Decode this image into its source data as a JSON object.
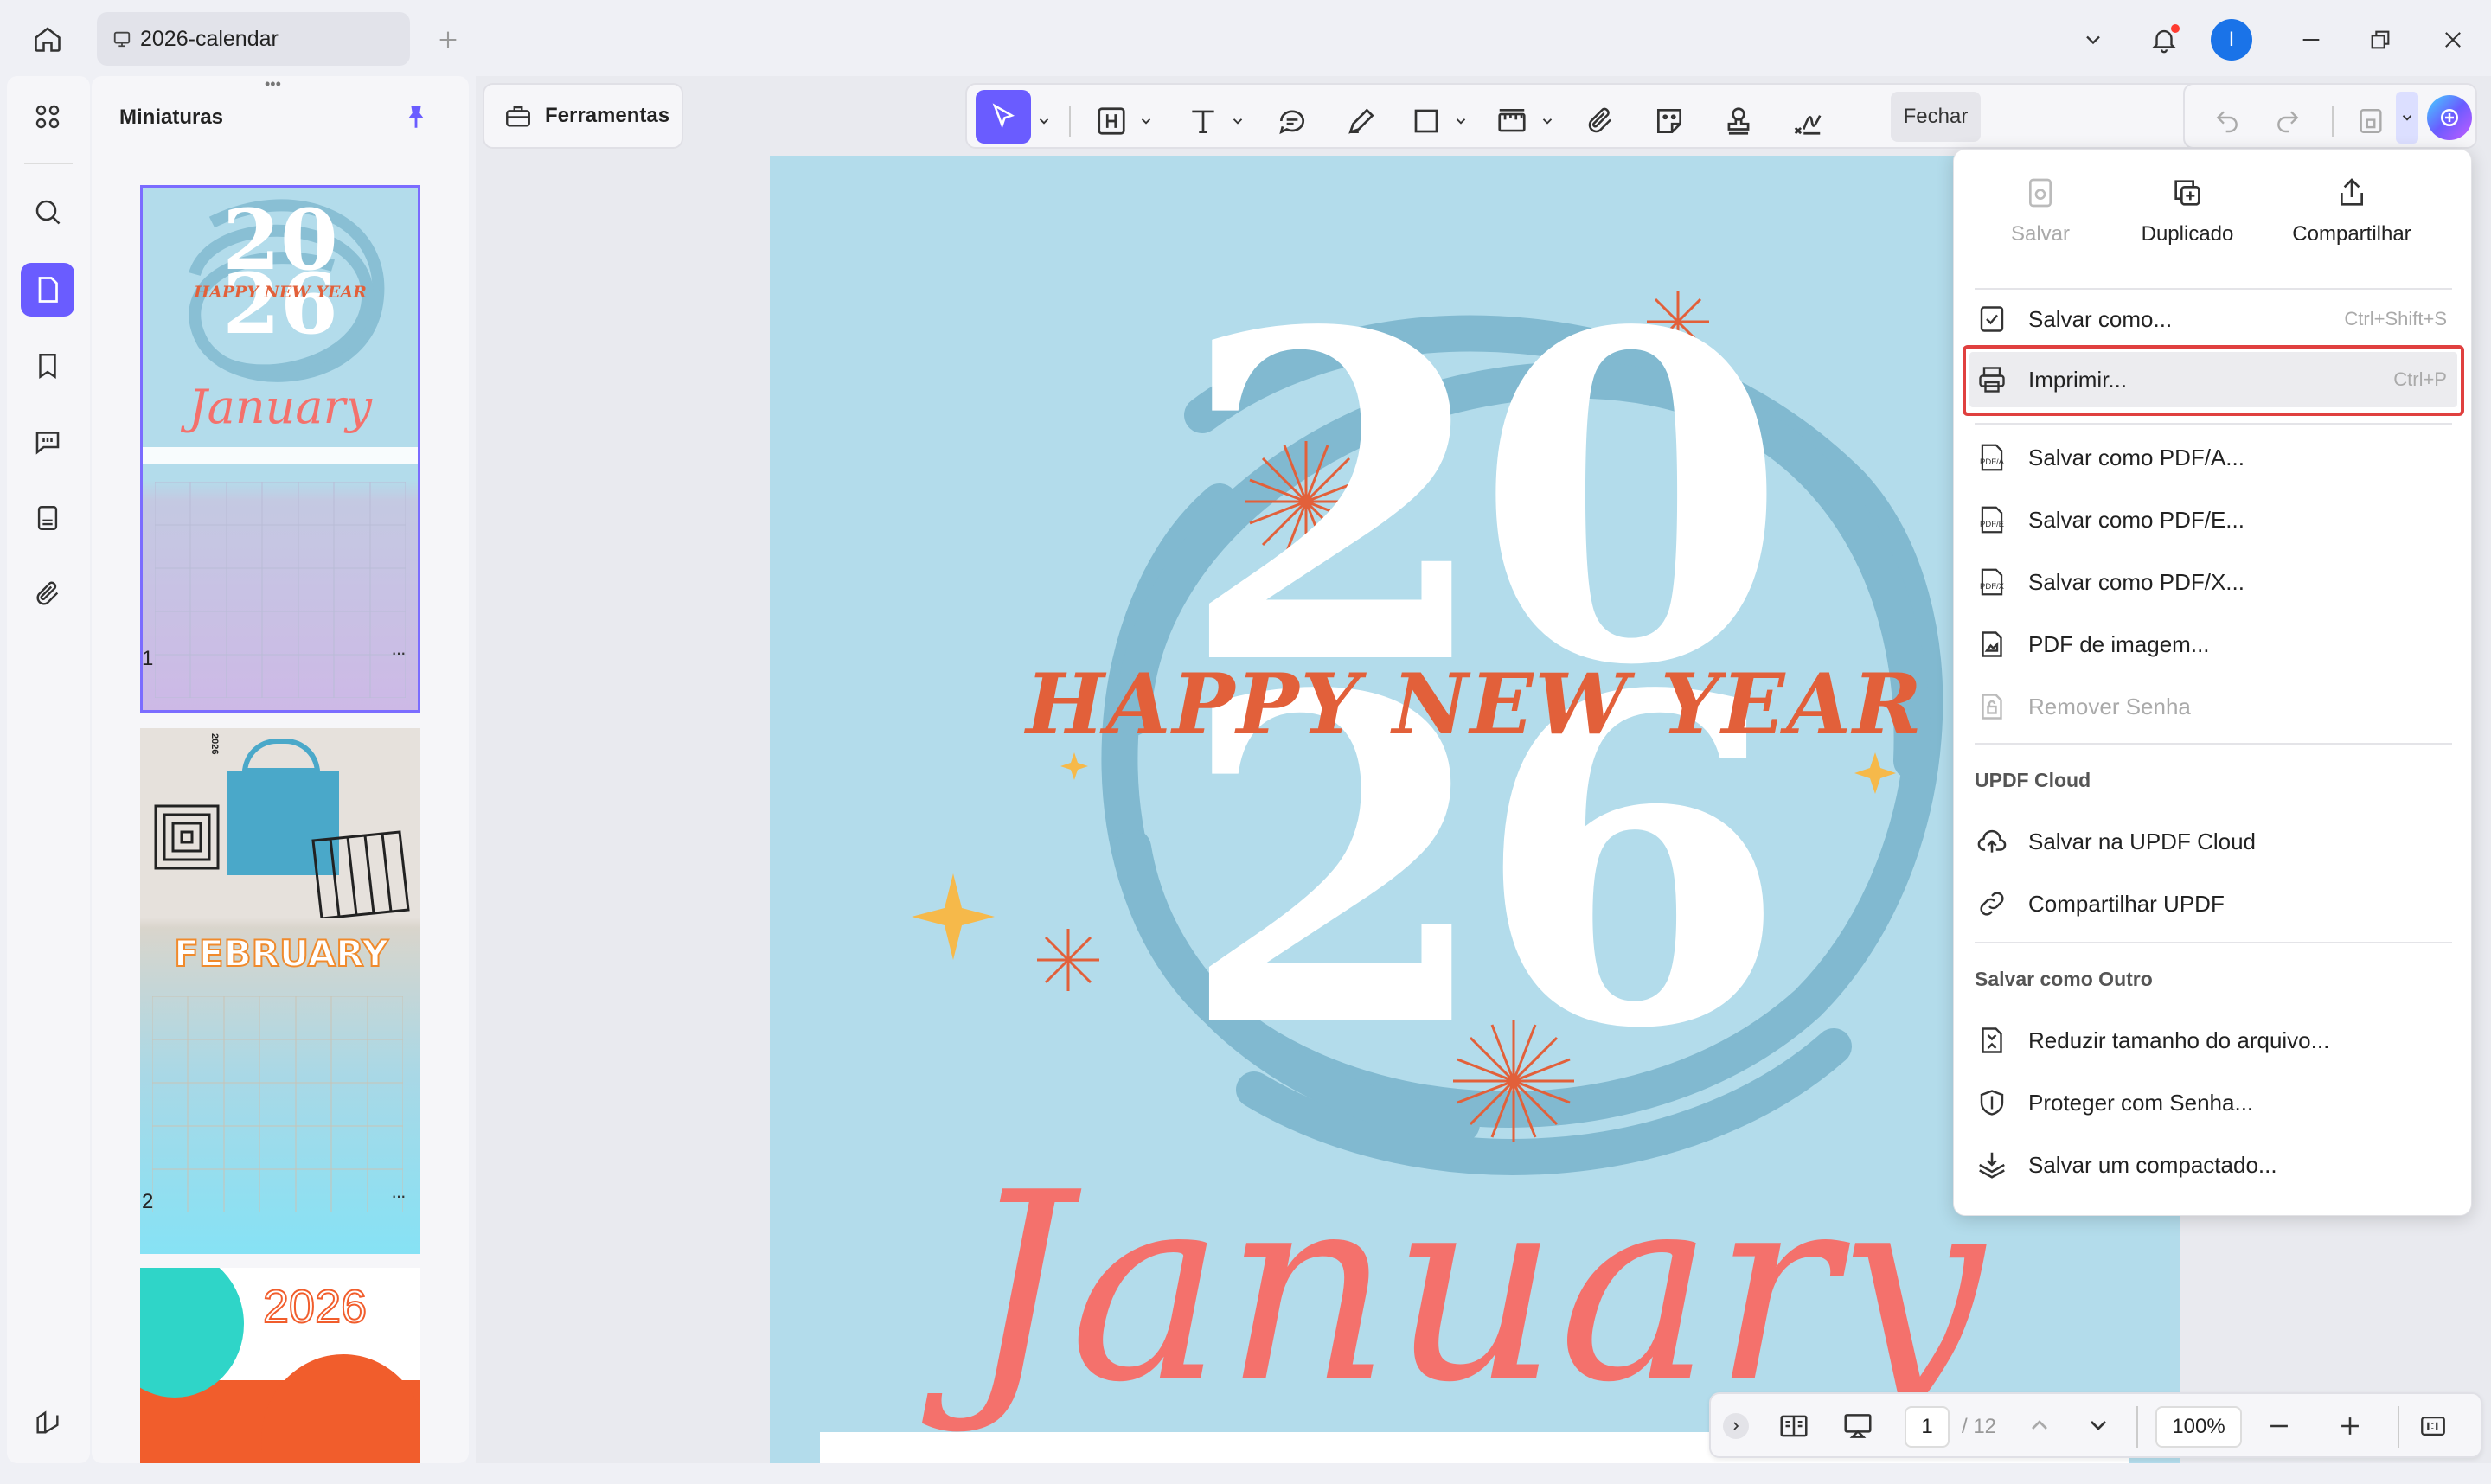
{
  "tab": {
    "title": "2026-calendar"
  },
  "sidebar": {
    "title": "Miniaturas",
    "pages": [
      {
        "number": "1"
      },
      {
        "number": "2"
      }
    ],
    "more": "···"
  },
  "toolbar": {
    "tools_label": "Ferramentas",
    "close_label": "Fechar"
  },
  "page": {
    "year_top": "20",
    "year_bottom": "26",
    "greeting": "Happy New Year",
    "month": "January"
  },
  "thumb_texts": {
    "t1_year_top": "20",
    "t1_year_bottom": "26",
    "t1_greeting": "Happy New Year",
    "t1_month": "January",
    "t2_year": "2026",
    "t2_month": "FEBRUARY",
    "t3_year": "2026"
  },
  "menu": {
    "top": {
      "save": "Salvar",
      "duplicate": "Duplicado",
      "share": "Compartilhar"
    },
    "items": [
      {
        "label": "Salvar como...",
        "shortcut": "Ctrl+Shift+S"
      },
      {
        "label": "Imprimir...",
        "shortcut": "Ctrl+P"
      },
      {
        "label": "Salvar como PDF/A..."
      },
      {
        "label": "Salvar como PDF/E..."
      },
      {
        "label": "Salvar como PDF/X..."
      },
      {
        "label": "PDF de imagem..."
      },
      {
        "label": "Remover Senha"
      }
    ],
    "cloud_section": "UPDF Cloud",
    "cloud_items": [
      {
        "label": "Salvar na UPDF Cloud"
      },
      {
        "label": "Compartilhar UPDF"
      }
    ],
    "other_section": "Salvar como Outro",
    "other_items": [
      {
        "label": "Reduzir tamanho do arquivo..."
      },
      {
        "label": "Proteger com Senha..."
      },
      {
        "label": "Salvar um compactado..."
      }
    ]
  },
  "bottom": {
    "page_current": "1",
    "page_total": "/ 12",
    "zoom": "100%"
  },
  "user": {
    "initial": "I"
  },
  "colors": {
    "accent": "#6a5cff",
    "page_bg": "#b3dceb",
    "swirl": "#7fb8cf",
    "orange": "#e2603a",
    "coral": "#f4716c",
    "highlight_border": "#e0403f"
  }
}
